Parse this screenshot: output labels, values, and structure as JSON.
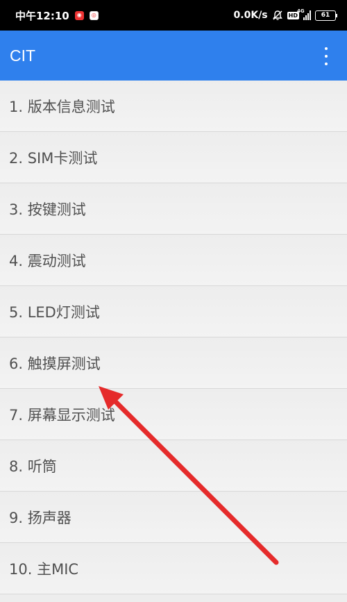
{
  "status_bar": {
    "time": "中午12:10",
    "network_speed": "0.0K/s",
    "network_type": "4G",
    "hd_badge": "HD",
    "battery": "61",
    "notification_icons": [
      "red-app-icon",
      "white-app-icon"
    ],
    "status_icons": [
      "muted-bell-icon",
      "hd-icon",
      "signal-icon",
      "battery-icon"
    ]
  },
  "app_bar": {
    "title": "CIT",
    "menu_icon": "overflow-menu-icon",
    "background_color": "#2f80ed"
  },
  "test_list": {
    "items": [
      {
        "label": "1. 版本信息测试"
      },
      {
        "label": "2. SIM卡测试"
      },
      {
        "label": "3. 按键测试"
      },
      {
        "label": "4. 震动测试"
      },
      {
        "label": "5. LED灯测试"
      },
      {
        "label": "6. 触摸屏测试"
      },
      {
        "label": "7. 屏幕显示测试"
      },
      {
        "label": "8. 听筒"
      },
      {
        "label": "9. 扬声器"
      },
      {
        "label": "10. 主MIC"
      }
    ]
  },
  "annotation": {
    "type": "arrow",
    "color": "#e52b2b",
    "points_to": "6. 触摸屏测试"
  }
}
